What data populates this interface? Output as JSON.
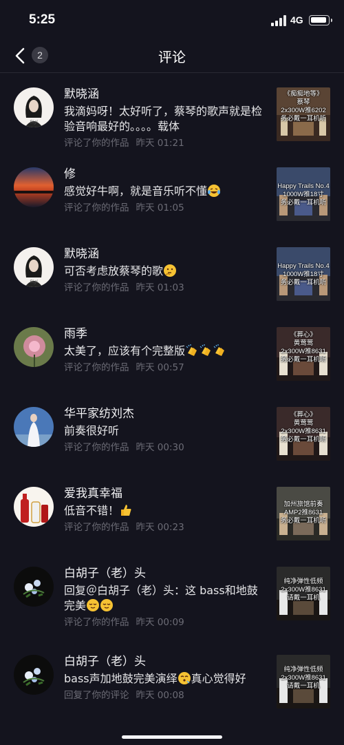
{
  "status_bar": {
    "time": "5:25",
    "network": "4G"
  },
  "nav": {
    "title": "评论",
    "badge_count": "2"
  },
  "comments": [
    {
      "name": "默晓涵",
      "text": "我滴妈呀！太好听了，蔡琴的歌声就是检验音响最好的。。。。载体",
      "action": "评论了你的作品",
      "time": "昨天 01:21",
      "avatar": "woman-portrait-avatar",
      "thumb": [
        "《痴痴地等》",
        "蔡琴",
        "2x300W推6202",
        "务必戴一耳机听"
      ],
      "emoji": ""
    },
    {
      "name": "修",
      "text": "感觉好牛啊，就是音乐听不懂",
      "action": "评论了你的作品",
      "time": "昨天 01:05",
      "avatar": "sunset-avatar",
      "thumb": [
        "Happy Trails No.4",
        "1000W推18寸",
        "务必戴一耳机听"
      ],
      "emoji": "laughing-crying-emoji"
    },
    {
      "name": "默晓涵",
      "text": "可否考虑放蔡琴的歌",
      "action": "评论了你的作品",
      "time": "昨天 01:03",
      "avatar": "woman-portrait-avatar",
      "thumb": [
        "Happy Trails No.4",
        "1000W推18寸",
        "务必戴一耳机听"
      ],
      "emoji": "thinking-emoji"
    },
    {
      "name": "雨季",
      "text": "太美了，应该有个完整版",
      "action": "评论了你的作品",
      "time": "昨天 00:57",
      "avatar": "pink-flower-avatar",
      "thumb": [
        "《葬心》",
        "黄莺莺",
        "2x300W推8631",
        "务必戴一耳机听"
      ],
      "emoji": "clapping-emoji"
    },
    {
      "name": "华平家纺刘杰",
      "text": "前奏很好听",
      "action": "评论了你的作品",
      "time": "昨天 00:30",
      "avatar": "bride-avatar",
      "thumb": [
        "《葬心》",
        "黄莺莺",
        "2x300W推8631",
        "务必戴一耳机听"
      ],
      "emoji": ""
    },
    {
      "name": "爱我真幸福",
      "text": "低音不错！",
      "action": "评论了你的作品",
      "time": "昨天 00:23",
      "avatar": "liquor-bottles-avatar",
      "thumb": [
        "加州旅馆前奏",
        "AMP2推8631",
        "务必戴一耳机听"
      ],
      "emoji": "thumbs-up-emoji"
    },
    {
      "name": "白胡子（老）头",
      "text": "回复＠白胡子（老）头：这 bass和地鼓完美",
      "action": "评论了你的作品",
      "time": "昨天 00:09",
      "avatar": "dark-flowers-avatar",
      "thumb": [
        "纯净弹性低频",
        "2x300W推8631",
        "请戴一耳机"
      ],
      "emoji": "relieved-emoji"
    },
    {
      "name": "白胡子（老）头",
      "text": "bass声加地鼓完美演绎",
      "text2": "真心觉得好",
      "action": "回复了你的评论",
      "time": "昨天 00:08",
      "avatar": "dark-flowers-avatar",
      "thumb": [
        "纯净弹性低频",
        "2x300W推8631",
        "请戴一耳机"
      ],
      "emoji": "kissing-emoji"
    }
  ]
}
